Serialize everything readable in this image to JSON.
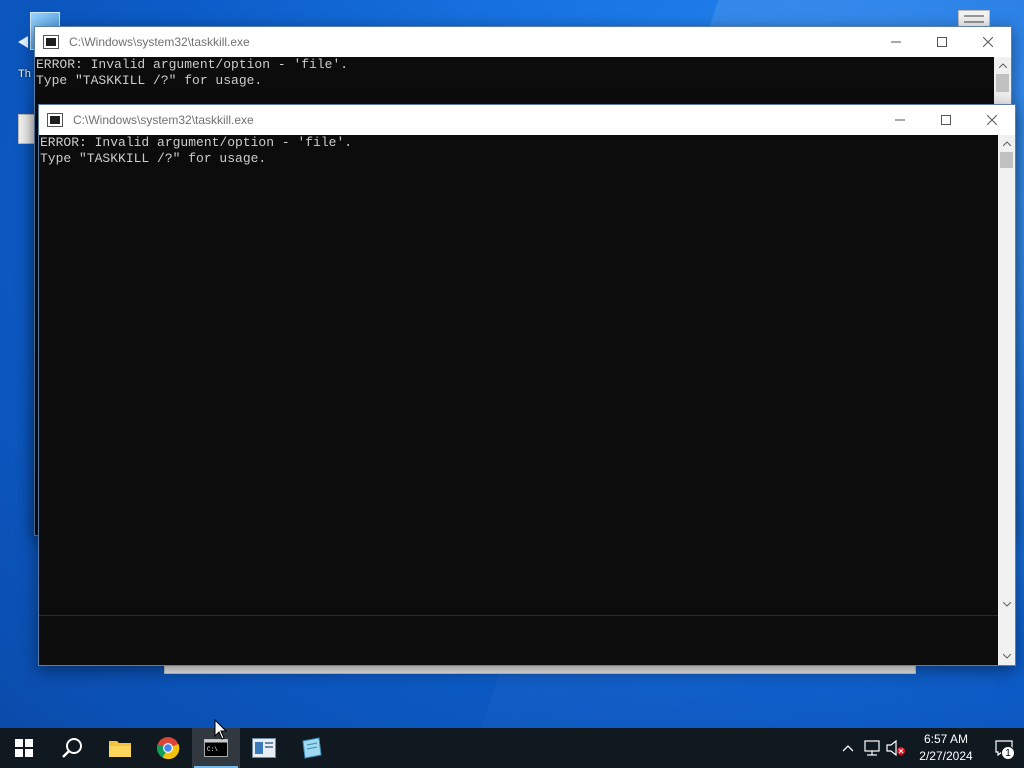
{
  "desktop": {
    "icon_label_top_left": "Th"
  },
  "console_back": {
    "title": "C:\\Windows\\system32\\taskkill.exe",
    "lines": [
      "ERROR: Invalid argument/option - 'file'.",
      "Type \"TASKKILL /?\" for usage."
    ]
  },
  "console_front": {
    "title": "C:\\Windows\\system32\\taskkill.exe",
    "lines": [
      "ERROR: Invalid argument/option - 'file'.",
      "Type \"TASKKILL /?\" for usage."
    ]
  },
  "window_controls": {
    "minimize_icon": "minimize-icon",
    "maximize_icon": "maximize-icon",
    "close_icon": "close-icon"
  },
  "taskbar": {
    "pinned": [
      "start-button",
      "search-button",
      "file-explorer",
      "chrome",
      "command-prompt",
      "app-window",
      "notepad-like-app"
    ],
    "active_item": "command-prompt",
    "clock_time": "6:57 AM",
    "clock_date": "2/27/2024",
    "notification_count": "1"
  },
  "colors": {
    "taskbar_bg": "#101820",
    "console_bg": "#0c0c0c",
    "console_text": "#cccccc",
    "active_underline": "#76b9ed"
  }
}
